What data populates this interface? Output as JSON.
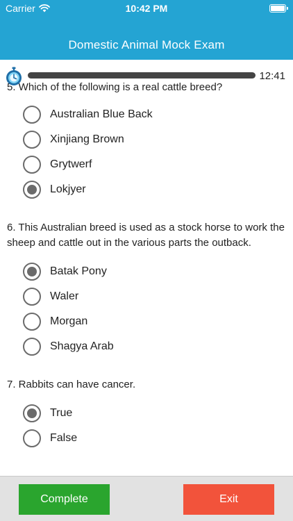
{
  "status_bar": {
    "carrier": "Carrier",
    "time": "10:42 PM"
  },
  "nav": {
    "title": "Domestic Animal Mock Exam"
  },
  "timer": {
    "remaining": "12:41",
    "elapsed_fraction": 0.0
  },
  "questions": [
    {
      "text": "5. Which of the following is a real cattle breed?",
      "options": [
        {
          "label": "Australian Blue Back",
          "selected": false
        },
        {
          "label": "Xinjiang Brown",
          "selected": false
        },
        {
          "label": "Grytwerf",
          "selected": false
        },
        {
          "label": "Lokjyer",
          "selected": true
        }
      ]
    },
    {
      "text": "6. This Australian breed is used as a stock horse to work the sheep and cattle out in the various parts the outback.",
      "options": [
        {
          "label": "Batak Pony",
          "selected": true
        },
        {
          "label": "Waler",
          "selected": false
        },
        {
          "label": "Morgan",
          "selected": false
        },
        {
          "label": "Shagya Arab",
          "selected": false
        }
      ]
    },
    {
      "text": "7. Rabbits can have cancer.",
      "options": [
        {
          "label": "True",
          "selected": true
        },
        {
          "label": "False",
          "selected": false
        }
      ]
    }
  ],
  "footer": {
    "complete_label": "Complete",
    "exit_label": "Exit"
  },
  "colors": {
    "header": "#24A4D3",
    "complete": "#2AA52E",
    "exit": "#F2533B",
    "radio": "#6b6b6b"
  }
}
